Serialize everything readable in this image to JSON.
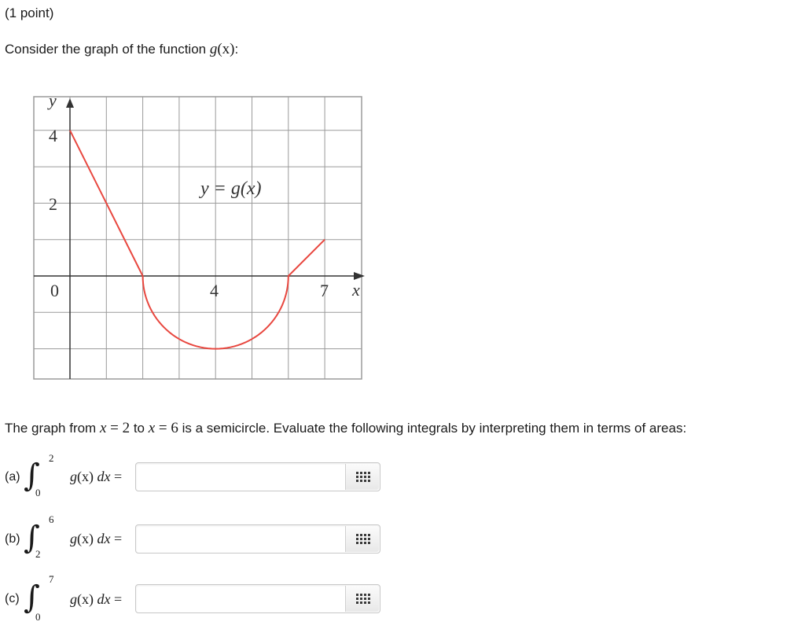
{
  "problem": {
    "points": "(1 point)",
    "intro_prefix": "Consider the graph of the function ",
    "intro_func": "g",
    "intro_arg": "(x)",
    "intro_suffix": ":",
    "statement_p1": "The graph from ",
    "statement_x1": "x",
    "statement_eq1": " = ",
    "statement_v1": "2",
    "statement_p2": " to ",
    "statement_x2": "x",
    "statement_eq2": " = ",
    "statement_v2": "6",
    "statement_p3": " is a semicircle. Evaluate the following integrals by interpreting them in terms of areas:"
  },
  "graph": {
    "y_axis_label": "y",
    "x_axis_label": "x",
    "curve_label": "y = g(x)",
    "tick_y4": "4",
    "tick_y2": "2",
    "tick_origin": "0",
    "tick_x4": "4",
    "tick_x7": "7",
    "curve_color": "#e8473f",
    "grid_color": "#9a9a9a"
  },
  "chart_data": {
    "type": "line",
    "title": "",
    "xlabel": "x",
    "ylabel": "y",
    "xlim": [
      -1,
      8
    ],
    "ylim": [
      -3,
      5
    ],
    "series": [
      {
        "name": "y = g(x)",
        "segments": [
          {
            "kind": "line",
            "points": [
              [
                0,
                4
              ],
              [
                2,
                0
              ]
            ]
          },
          {
            "kind": "semicircle_lower",
            "center": [
              4,
              0
            ],
            "radius": 2
          },
          {
            "kind": "line",
            "points": [
              [
                6,
                0
              ],
              [
                7,
                1
              ]
            ]
          }
        ]
      }
    ]
  },
  "questions": [
    {
      "label": "(a)",
      "upper": "2",
      "lower": "0",
      "integrand_func": "g",
      "integrand_arg": "(x)",
      "integrand_d": " dx",
      "equals": " =",
      "value": ""
    },
    {
      "label": "(b)",
      "upper": "6",
      "lower": "2",
      "integrand_func": "g",
      "integrand_arg": "(x)",
      "integrand_d": " dx",
      "equals": " =",
      "value": ""
    },
    {
      "label": "(c)",
      "upper": "7",
      "lower": "0",
      "integrand_func": "g",
      "integrand_arg": "(x)",
      "integrand_d": " dx",
      "equals": " =",
      "value": ""
    }
  ]
}
